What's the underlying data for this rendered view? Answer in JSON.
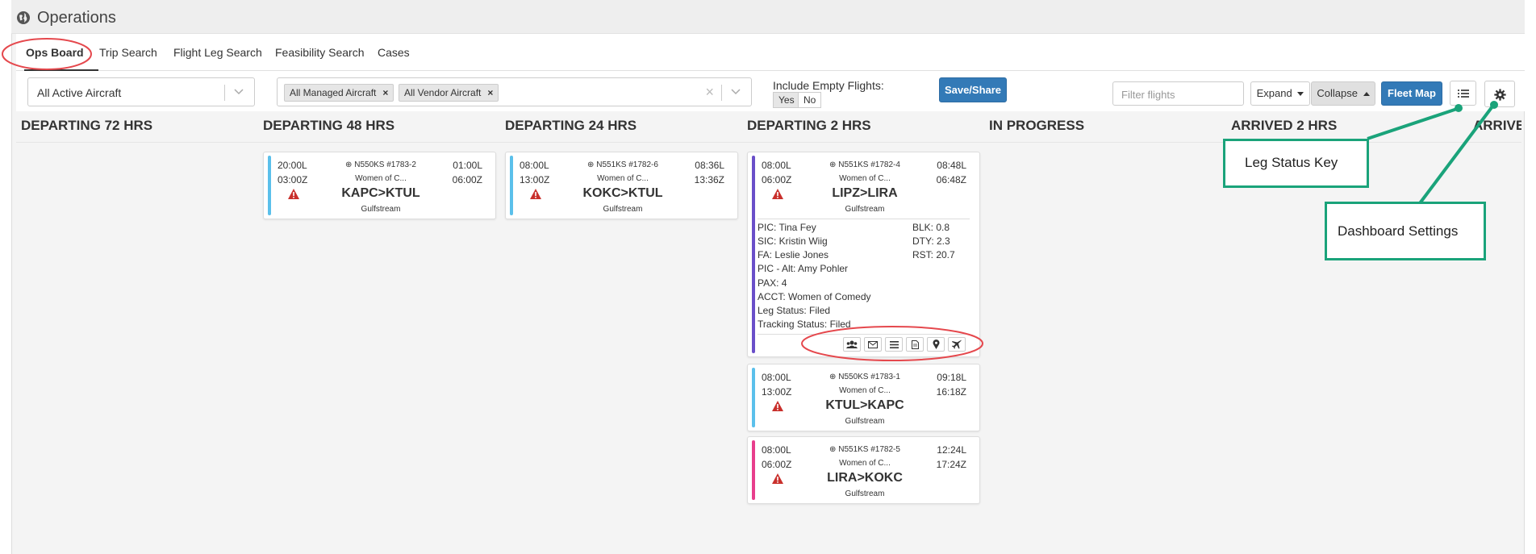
{
  "app": {
    "title": "Operations"
  },
  "tabs": [
    {
      "label": "Ops Board"
    },
    {
      "label": "Trip Search"
    },
    {
      "label": "Flight Leg Search"
    },
    {
      "label": "Feasibility Search"
    },
    {
      "label": "Cases"
    }
  ],
  "filters": {
    "aircraft_select": "All Active Aircraft",
    "chips": [
      "All Managed Aircraft",
      "All Vendor Aircraft"
    ],
    "chip_close": "×",
    "clear": "×",
    "include_empty_label": "Include Empty Flights:",
    "yes": "Yes",
    "no": "No",
    "save_share": "Save/Share",
    "filter_placeholder": "Filter flights",
    "expand": "Expand",
    "collapse": "Collapse",
    "fleet_map": "Fleet Map"
  },
  "columns": [
    "DEPARTING 72 HRS",
    "DEPARTING 48 HRS",
    "DEPARTING 24 HRS",
    "DEPARTING 2 HRS",
    "IN PROGRESS",
    "ARRIVED 2 HRS",
    "ARRIVE"
  ],
  "cards": {
    "c48": {
      "local_dep": "20:00L",
      "zulu_dep": "03:00Z",
      "tail": "N550KS #1783-2",
      "customer": "Women of C...",
      "local_arr": "01:00L",
      "zulu_arr": "06:00Z",
      "route": "KAPC>KTUL",
      "type": "Gulfstream",
      "status_color": "#5bc0eb"
    },
    "c24": {
      "local_dep": "08:00L",
      "zulu_dep": "13:00Z",
      "tail": "N551KS #1782-6",
      "customer": "Women of C...",
      "local_arr": "08:36L",
      "zulu_arr": "13:36Z",
      "route": "KOKC>KTUL",
      "type": "Gulfstream",
      "status_color": "#5bc0eb"
    },
    "c2a": {
      "local_dep": "08:00L",
      "zulu_dep": "06:00Z",
      "tail": "N551KS #1782-4",
      "customer": "Women of C...",
      "local_arr": "08:48L",
      "zulu_arr": "06:48Z",
      "route": "LIPZ>LIRA",
      "type": "Gulfstream",
      "status_color": "#6a4fc9",
      "details": [
        "PIC: Tina Fey",
        "SIC: Kristin  Wiig",
        "FA: Leslie Jones",
        "PIC - Alt: Amy Pohler",
        "PAX: 4",
        "ACCT: Women of Comedy",
        "Leg Status: Filed",
        "Tracking Status: Filed"
      ],
      "stats": [
        "BLK: 0.8",
        "DTY: 2.3",
        "RST: 20.7"
      ]
    },
    "c2b": {
      "local_dep": "08:00L",
      "zulu_dep": "13:00Z",
      "tail": "N550KS #1783-1",
      "customer": "Women of C...",
      "local_arr": "09:18L",
      "zulu_arr": "16:18Z",
      "route": "KTUL>KAPC",
      "type": "Gulfstream",
      "status_color": "#5bc0eb"
    },
    "c2c": {
      "local_dep": "08:00L",
      "zulu_dep": "06:00Z",
      "tail": "N551KS #1782-5",
      "customer": "Women of C...",
      "local_arr": "12:24L",
      "zulu_arr": "17:24Z",
      "route": "LIRA>KOKC",
      "type": "Gulfstream",
      "status_color": "#e83e8c"
    }
  },
  "callouts": {
    "leg_status_key": "Leg Status Key",
    "dashboard_settings": "Dashboard Settings"
  },
  "colors": {
    "primary": "#337ab7",
    "callout": "#1aa37a",
    "annotation": "#e5484d",
    "warning": "#c9302c"
  },
  "icons": [
    "globe-icon",
    "chevron-down-icon",
    "list-icon",
    "gear-icon",
    "warning-icon",
    "users-icon",
    "envelope-icon",
    "menu-icon",
    "document-icon",
    "location-pin-icon",
    "airplane-icon",
    "crosshair-icon"
  ]
}
